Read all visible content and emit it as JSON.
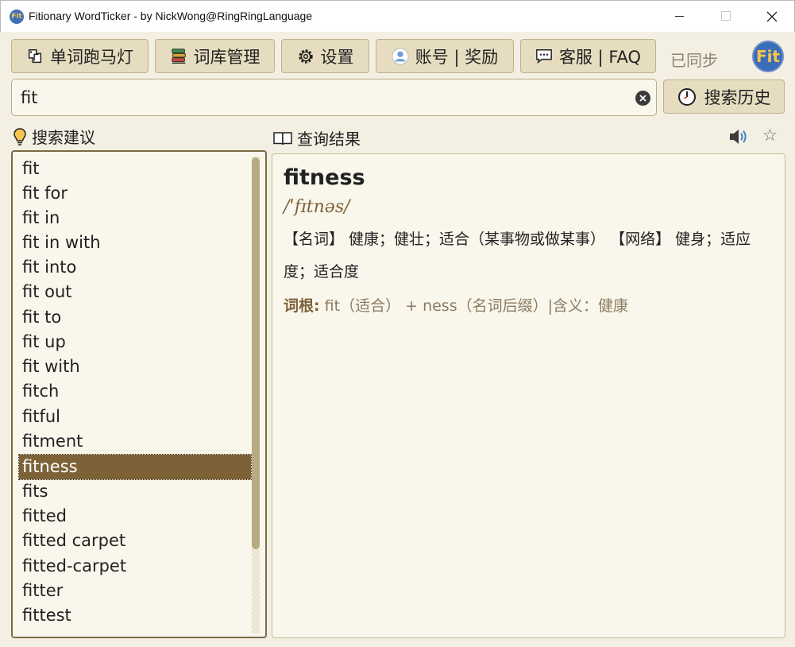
{
  "window": {
    "app_icon_text": "Fit",
    "title": "Fitionary WordTicker - by NickWong@RingRingLanguage"
  },
  "toolbar": {
    "ticker_label": "单词跑马灯",
    "ticker_icon": "ticker-icon",
    "library_label": "词库管理",
    "library_icon": "books-icon",
    "settings_label": "设置",
    "settings_icon": "gear-icon",
    "account_label": "账号 | 奖励",
    "account_icon": "user-icon",
    "support_label": "客服 | FAQ",
    "support_icon": "chat-icon",
    "sync_status": "已同步",
    "avatar_text": "Fit"
  },
  "search": {
    "value": "fit",
    "history_label": "搜索历史",
    "history_icon": "clock-icon"
  },
  "suggestions": {
    "header": "搜索建议",
    "items": [
      "fit",
      "fit for",
      "fit in",
      "fit in with",
      "fit into",
      "fit out",
      "fit to",
      "fit up",
      "fit with",
      "fitch",
      "fitful",
      "fitment",
      "fitness",
      "fits",
      "fitted",
      "fitted carpet",
      "fitted-carpet",
      "fitter",
      "fittest"
    ],
    "selected_index": 12
  },
  "result": {
    "header": "查询结果",
    "word": "fitness",
    "phonetic": "/ˈfɪtnəs/",
    "definition": "【名词】 健康；健壮；适合（某事物或做某事） 【网络】 健身；适应度；适合度",
    "root_label": "词根:",
    "root_text": " fit（适合） + ness（名词后缀）|含义：健康"
  },
  "colors": {
    "background": "#f3efe2",
    "button": "#e6dcc0",
    "accent": "#7d6238",
    "avatar": "#3b6db8"
  }
}
